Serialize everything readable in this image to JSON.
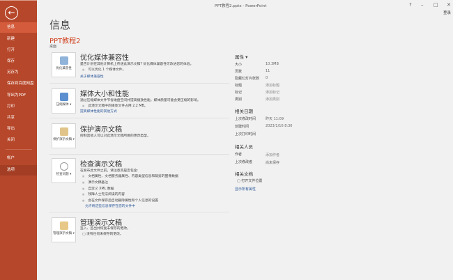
{
  "titlebar": {
    "title": "PPT教程2.pptx - PowerPoint",
    "help": "?",
    "minimize": "–",
    "maximize": "□",
    "close": "✕",
    "login": "登录"
  },
  "sidebar": {
    "back_icon": "←",
    "items": [
      {
        "label": "信息"
      },
      {
        "label": "新建"
      },
      {
        "label": "打开"
      },
      {
        "label": "保存"
      },
      {
        "label": "另存为"
      },
      {
        "label": "保存到百度网盘"
      },
      {
        "label": "导出为PDF"
      },
      {
        "label": "打印"
      },
      {
        "label": "共享"
      },
      {
        "label": "导出"
      },
      {
        "label": "关闭"
      },
      {
        "label": "帐户"
      },
      {
        "label": "选项"
      }
    ]
  },
  "main": {
    "heading": "信息",
    "file_name": "PPT教程2",
    "location": "桌面",
    "sections": [
      {
        "button": "优化兼容性",
        "title": "优化媒体兼容性",
        "desc": "是否计划在其他计算机上传递此演示文稿? 优化媒体兼容性可改进您的体验。",
        "bullets": [
          "可以优化 1 个媒体文件。"
        ],
        "link": "关于媒体兼容性"
      },
      {
        "button": "压缩媒体 ▾",
        "title": "媒体大小和性能",
        "desc": "通过压缩媒体文件节省磁盘空间并提高播放性能。媒体质量可能会受压缩的影响。",
        "bullets": [
          "此演示文稿中的媒体文件占用 2.2 MB。"
        ],
        "link": "提高媒体性能的其他方式"
      },
      {
        "button": "保护演示文稿 ▾",
        "title": "保护演示文稿",
        "desc": "控制其他人可以对此演示文稿所做的更改类型。",
        "bullets": [],
        "link": ""
      },
      {
        "button": "检查问题 ▾",
        "title": "检查演示文稿",
        "desc": "在发布此文件之前，请注意其是否包含:",
        "bullets": [
          "文档属性、文档服务器属性、内容类型信息和裁剪的图像数据",
          "演示文稿备注",
          "自定义 XML 数据",
          "残障人士无法阅读的内容",
          "会在文件保存后自动删除属性和个人信息的设置"
        ],
        "link": "允许将这些信息保存在您的文件中"
      },
      {
        "button": "管理演示文稿 ▾",
        "title": "管理演示文稿",
        "desc": "签入、签出并恢复未保存的更改。",
        "bullets": [
          "没有任何未保存的更改。"
        ],
        "link": ""
      }
    ]
  },
  "properties": {
    "heading": "属性 ▾",
    "rows": [
      {
        "k": "大小",
        "v": "10.3MB"
      },
      {
        "k": "页数",
        "v": "11"
      },
      {
        "k": "隐藏幻灯片张数",
        "v": "0"
      },
      {
        "k": "标题",
        "v": "添加标题"
      },
      {
        "k": "标记",
        "v": "添加标记"
      },
      {
        "k": "类别",
        "v": "添加类别"
      }
    ],
    "dates_heading": "相关日期",
    "dates": [
      {
        "k": "上次修改时间",
        "v": "昨天 11:09"
      },
      {
        "k": "创建时间",
        "v": "2023/1/16 8:30"
      },
      {
        "k": "上次打印时间",
        "v": ""
      }
    ],
    "people_heading": "相关人员",
    "people": [
      {
        "k": "作者",
        "v": "添加作者"
      },
      {
        "k": "上次修改者",
        "v": "尚未保存"
      }
    ],
    "docs_heading": "相关文档",
    "open_location": "打开文件位置",
    "show_all": "显示所有属性"
  },
  "colors": {
    "accent": "#b7472a",
    "link": "#2b579a",
    "title_orange": "#d24726"
  }
}
